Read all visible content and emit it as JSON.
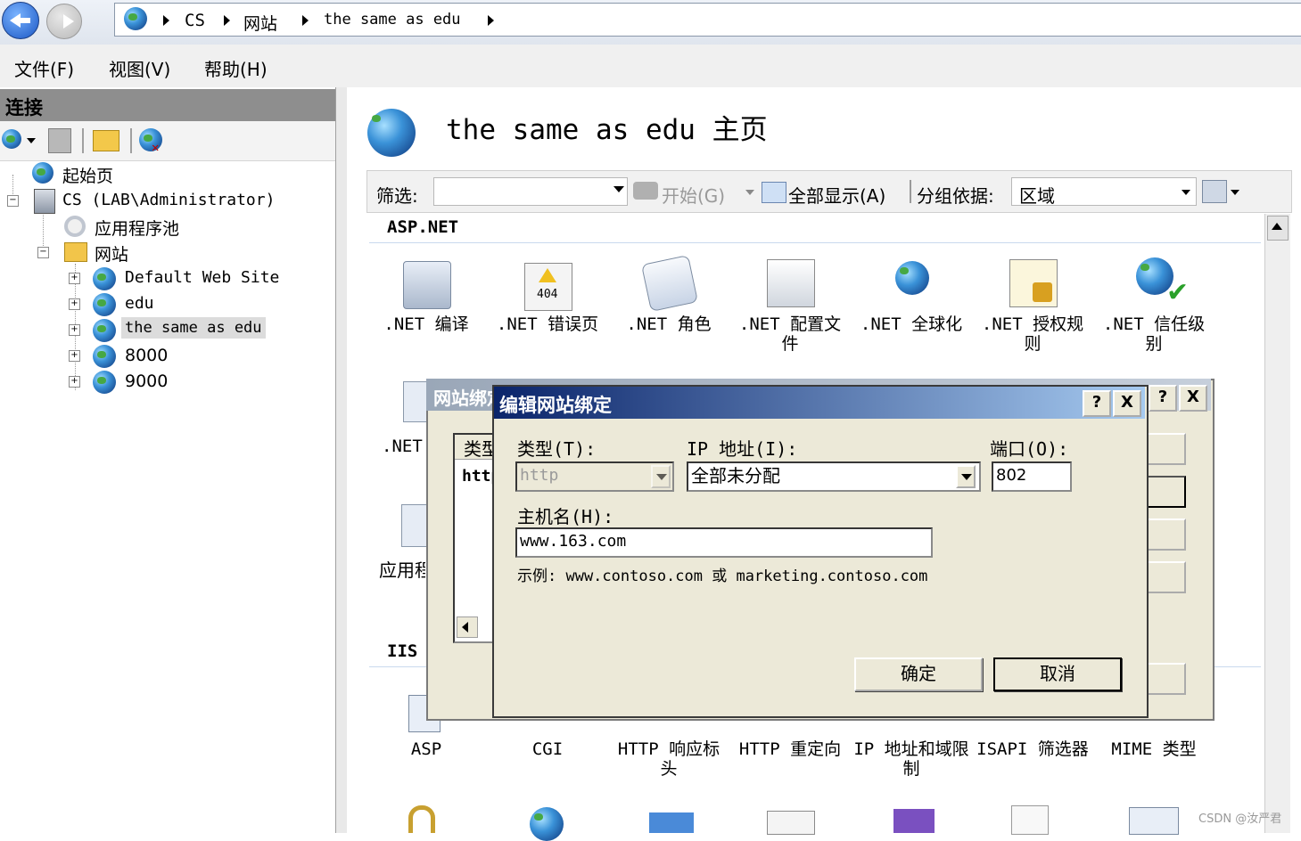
{
  "breadcrumb": [
    "CS",
    "网站",
    "the same as edu"
  ],
  "menu": [
    "文件(F)",
    "视图(V)",
    "帮助(H)"
  ],
  "left": {
    "header": "连接",
    "tree": {
      "start_page": "起始页",
      "server": "CS (LAB\\Administrator)",
      "app_pools": "应用程序池",
      "sites": "网站",
      "site_list": [
        "Default Web Site",
        "edu",
        "the same as edu",
        "8000",
        "9000"
      ]
    }
  },
  "main": {
    "title": "the same as edu 主页",
    "filter": {
      "label": "筛选:",
      "start": "开始(G)",
      "show_all": "全部显示(A)",
      "group_by_label": "分组依据:",
      "group_by_value": "区域"
    },
    "groups": {
      "aspnet": "ASP.NET",
      "iis": "IIS"
    },
    "aspnet_features": [
      ".NET 编译",
      ".NET 错误页",
      ".NET 角色",
      ".NET 配置文件",
      ".NET 全球化",
      ".NET 授权规则",
      ".NET 信任级别"
    ],
    "partial_labels": {
      "row2_label": ".NET",
      "row3_label": "应用程序",
      "error_badge": "404"
    },
    "iis_features": [
      "ASP",
      "CGI",
      "HTTP 响应标头",
      "HTTP 重定向",
      "IP 地址和域限制",
      "ISAPI 筛选器",
      "MIME 类型"
    ]
  },
  "bg_dialog": {
    "title": "网站绑定",
    "col_type": "类型",
    "row_value": "http",
    "help": "?",
    "close": "X"
  },
  "dialog": {
    "title": "编辑网站绑定",
    "type_label": "类型(T):",
    "type_value": "http",
    "ip_label": "IP 地址(I):",
    "ip_value": "全部未分配",
    "port_label": "端口(O):",
    "port_value": "802",
    "host_label": "主机名(H):",
    "host_value": "www.163.com",
    "example": "示例: www.contoso.com 或 marketing.contoso.com",
    "ok": "确定",
    "cancel": "取消",
    "help": "?",
    "close": "X"
  },
  "watermark": "CSDN @汝严君"
}
